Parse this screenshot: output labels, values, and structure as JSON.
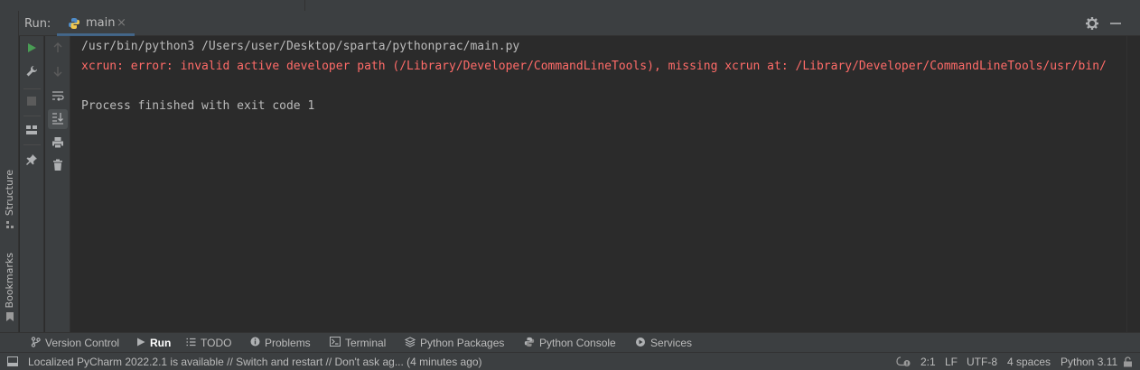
{
  "run_panel": {
    "title": "Run:",
    "tab": {
      "label": "main",
      "close": "×"
    }
  },
  "side_tabs": {
    "structure": "Structure",
    "bookmarks": "Bookmarks"
  },
  "console": {
    "lines": [
      {
        "text": "/usr/bin/python3 /Users/user/Desktop/sparta/pythonprac/main.py",
        "color": "#bbbbbb"
      },
      {
        "text": "xcrun: error: invalid active developer path (/Library/Developer/CommandLineTools), missing xcrun at: /Library/Developer/CommandLineTools/usr/bin/",
        "color": "#ff6b68"
      },
      {
        "text": "Process finished with exit code 1",
        "color": "#bbbbbb"
      }
    ]
  },
  "tool_windows": [
    {
      "label": "Version Control",
      "icon": "branch-icon"
    },
    {
      "label": "Run",
      "icon": "play-icon",
      "active": true
    },
    {
      "label": "TODO",
      "icon": "list-icon"
    },
    {
      "label": "Problems",
      "icon": "info-icon"
    },
    {
      "label": "Terminal",
      "icon": "terminal-icon"
    },
    {
      "label": "Python Packages",
      "icon": "layers-icon"
    },
    {
      "label": "Python Console",
      "icon": "python-icon"
    },
    {
      "label": "Services",
      "icon": "services-icon"
    }
  ],
  "status_bar": {
    "message": "Localized PyCharm 2022.2.1 is available // Switch and restart // Don't ask ag... (4 minutes ago)",
    "position": "2:1",
    "line_separator": "LF",
    "encoding": "UTF-8",
    "indent": "4 spaces",
    "interpreter": "Python 3.11"
  },
  "colors": {
    "accent": "#4a88c7",
    "run_green": "#499c54",
    "error_red": "#ff6b68",
    "panel_bg": "#3c3f41",
    "console_bg": "#2b2b2b"
  }
}
